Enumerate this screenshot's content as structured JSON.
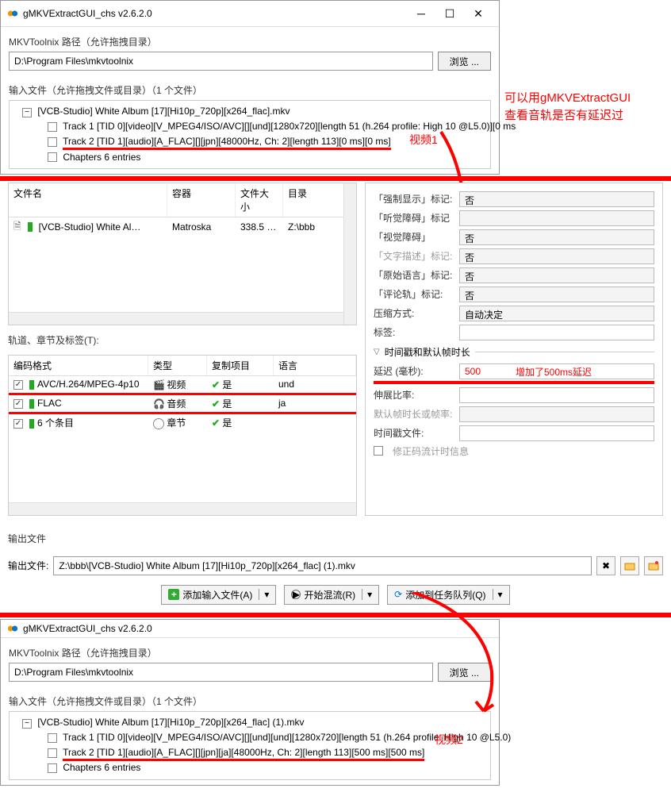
{
  "app1": {
    "title": "gMKVExtractGUI_chs v2.6.2.0",
    "toolnix_label": "MKVToolnix 路径（允许拖拽目录）",
    "toolnix_path": "D:\\Program Files\\mkvtoolnix",
    "browse": "浏览 ...",
    "input_label": "输入文件（允许拖拽文件或目录）（1 个文件）",
    "root": "[VCB-Studio] White Album [17][Hi10p_720p][x264_flac].mkv",
    "track1": "Track 1 [TID 0][video][V_MPEG4/ISO/AVC][][und][1280x720][length 51 (h.264 profile: High 10 @L5.0)][0 ms",
    "track2": "Track 2 [TID 1][audio][A_FLAC][][jpn][48000Hz, Ch: 2][length 113][0 ms][0 ms]",
    "chapters": "Chapters 6 entries"
  },
  "annot": {
    "top1": "可以用gMKVExtractGUI",
    "top2": "查看音轨是否有延迟过",
    "video1": "视频1",
    "video2": "视频2",
    "delay_note": "增加了500ms延迟"
  },
  "filelist": {
    "h_name": "文件名",
    "h_container": "容器",
    "h_size": "文件大小",
    "h_dir": "目录",
    "row_name": "[VCB-Studio] White Al…",
    "row_container": "Matroska",
    "row_size": "338.5 …",
    "row_dir": "Z:\\bbb"
  },
  "track_section": "轨道、章节及标签(T):",
  "tracks": {
    "h_codec": "编码格式",
    "h_type": "类型",
    "h_copy": "复制项目",
    "h_lang": "语言",
    "r1_codec": "AVC/H.264/MPEG-4p10",
    "r1_type": "视频",
    "r1_copy": "是",
    "r1_lang": "und",
    "r2_codec": "FLAC",
    "r2_type": "音频",
    "r2_copy": "是",
    "r2_lang": "ja",
    "r3_codec": "6 个条目",
    "r3_type": "章节",
    "r3_copy": "是"
  },
  "props": {
    "forced": "「强制显示」标记:",
    "forced_v": "否",
    "hearing": "「听觉障碍」标记",
    "visual": "「视觉障碍」",
    "visual_v": "否",
    "textdesc": "「文字描述」标记:",
    "textdesc_v": "否",
    "origlang": "「原始语言」标记:",
    "origlang_v": "否",
    "comment": "「评论轨」标记:",
    "comment_v": "否",
    "compress": "压缩方式:",
    "compress_v": "自动决定",
    "tags": "标签:",
    "time_section": "时间戳和默认帧时长",
    "delay": "延迟 (毫秒):",
    "delay_v": "500",
    "stretch": "伸展比率:",
    "framerate": "默认帧时长或帧率:",
    "timecode": "时间戳文件:",
    "fixbits": "修正码流计时信息"
  },
  "output": {
    "label": "输出文件",
    "filelabel": "输出文件:",
    "path": "Z:\\bbb\\[VCB-Studio] White Album [17][Hi10p_720p][x264_flac] (1).mkv"
  },
  "actions": {
    "add": "添加输入文件(A)",
    "mux": "开始混流(R)",
    "queue": "添加到任务队列(Q)"
  },
  "app2": {
    "title": "gMKVExtractGUI_chs v2.6.2.0",
    "toolnix_label": "MKVToolnix 路径（允许拖拽目录）",
    "toolnix_path": "D:\\Program Files\\mkvtoolnix",
    "browse": "浏览 ...",
    "input_label": "输入文件（允许拖拽文件或目录）（1 个文件）",
    "root": "[VCB-Studio] White Album [17][Hi10p_720p][x264_flac] (1).mkv",
    "track1": "Track 1 [TID 0][video][V_MPEG4/ISO/AVC][][und][und][1280x720][length 51 (h.264 profile: High 10 @L5.0)",
    "track2": "Track 2 [TID 1][audio][A_FLAC][][jpn][ja][48000Hz, Ch: 2][length 113][500 ms][500 ms]",
    "chapters": "Chapters 6 entries"
  }
}
